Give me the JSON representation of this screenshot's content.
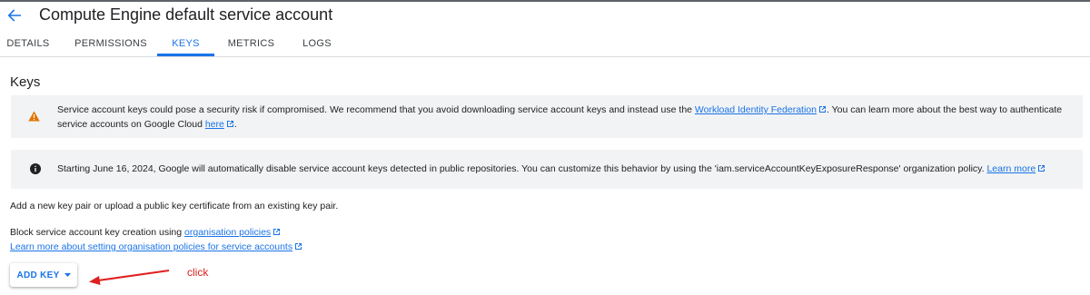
{
  "header": {
    "title": "Compute Engine default service account"
  },
  "tabs": [
    {
      "label": "DETAILS",
      "active": false
    },
    {
      "label": "PERMISSIONS",
      "active": false
    },
    {
      "label": "KEYS",
      "active": true
    },
    {
      "label": "METRICS",
      "active": false
    },
    {
      "label": "LOGS",
      "active": false
    }
  ],
  "keys": {
    "title": "Keys",
    "warning": {
      "icon": "warning-icon",
      "text_before": "Service account keys could pose a security risk if compromised. We recommend that you avoid downloading service account keys and instead use the ",
      "link1": "Workload Identity Federation",
      "text_middle": ". You can learn more about the best way to authenticate service accounts on Google Cloud ",
      "link2": "here",
      "text_after": "."
    },
    "info": {
      "icon": "info-icon",
      "text": "Starting June 16, 2024, Google will automatically disable service account keys detected in public repositories. You can customize this behavior by using the 'iam.serviceAccountKeyExposureResponse' organization policy. ",
      "link": "Learn more"
    },
    "add_description": "Add a new key pair or upload a public key certificate from an existing key pair.",
    "block_text": "Block service account key creation using ",
    "block_link": "organisation policies",
    "learn_link": "Learn more about setting organisation policies for service accounts",
    "add_key_button": "ADD KEY"
  },
  "annotation": {
    "text": "click",
    "color": "#e02020"
  },
  "colors": {
    "accent": "#1a73e8",
    "warning": "#e37400",
    "banner_bg": "#f1f3f4"
  }
}
